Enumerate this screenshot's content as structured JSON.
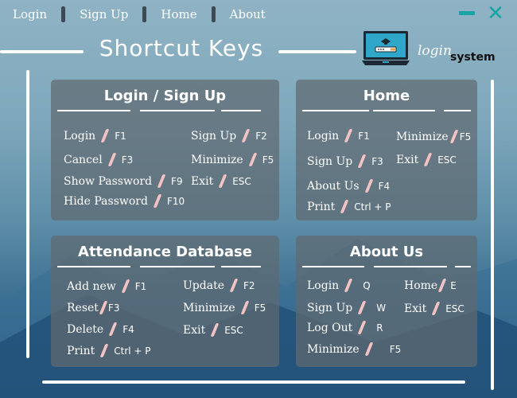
{
  "nav": {
    "login": "Login",
    "signup": "Sign Up",
    "home": "Home",
    "about": "About"
  },
  "window": {
    "minimize": "minimize",
    "close": "✕"
  },
  "title": "Shortcut Keys",
  "logo": {
    "login": "login",
    "system": "system"
  },
  "panels": {
    "login": {
      "title": "Login / Sign Up",
      "items": [
        {
          "label": "Login",
          "key": "F1"
        },
        {
          "label": "Sign Up",
          "key": "F2"
        },
        {
          "label": "Cancel",
          "key": "F3"
        },
        {
          "label": "Minimize",
          "key": "F5"
        },
        {
          "label": "Show Password",
          "key": "F9"
        },
        {
          "label": "Exit",
          "key": "ESC"
        },
        {
          "label": "Hide Password",
          "key": "F10"
        }
      ]
    },
    "home": {
      "title": "Home",
      "items": [
        {
          "label": "Login",
          "key": "F1"
        },
        {
          "label": "Minimize",
          "key": "F5"
        },
        {
          "label": "Sign Up",
          "key": "F3"
        },
        {
          "label": "Exit",
          "key": "ESC"
        },
        {
          "label": "About Us",
          "key": "F4"
        },
        {
          "label": "Print",
          "key": "Ctrl + P"
        }
      ]
    },
    "attendance": {
      "title": "Attendance Database",
      "items": [
        {
          "label": "Add new",
          "key": "F1"
        },
        {
          "label": "Update",
          "key": "F2"
        },
        {
          "label": "Reset",
          "key": "F3"
        },
        {
          "label": "Minimize",
          "key": "F5"
        },
        {
          "label": "Delete",
          "key": "F4"
        },
        {
          "label": "Exit",
          "key": "ESC"
        },
        {
          "label": "Print",
          "key": "Ctrl + P"
        }
      ]
    },
    "about": {
      "title": "About Us",
      "items": [
        {
          "label": "Login",
          "key": "Q"
        },
        {
          "label": "Home",
          "key": "E"
        },
        {
          "label": "Sign Up",
          "key": "W"
        },
        {
          "label": "Exit",
          "key": "ESC"
        },
        {
          "label": "Log Out",
          "key": "R"
        },
        {
          "label": "Minimize",
          "key": "F5"
        }
      ]
    }
  }
}
